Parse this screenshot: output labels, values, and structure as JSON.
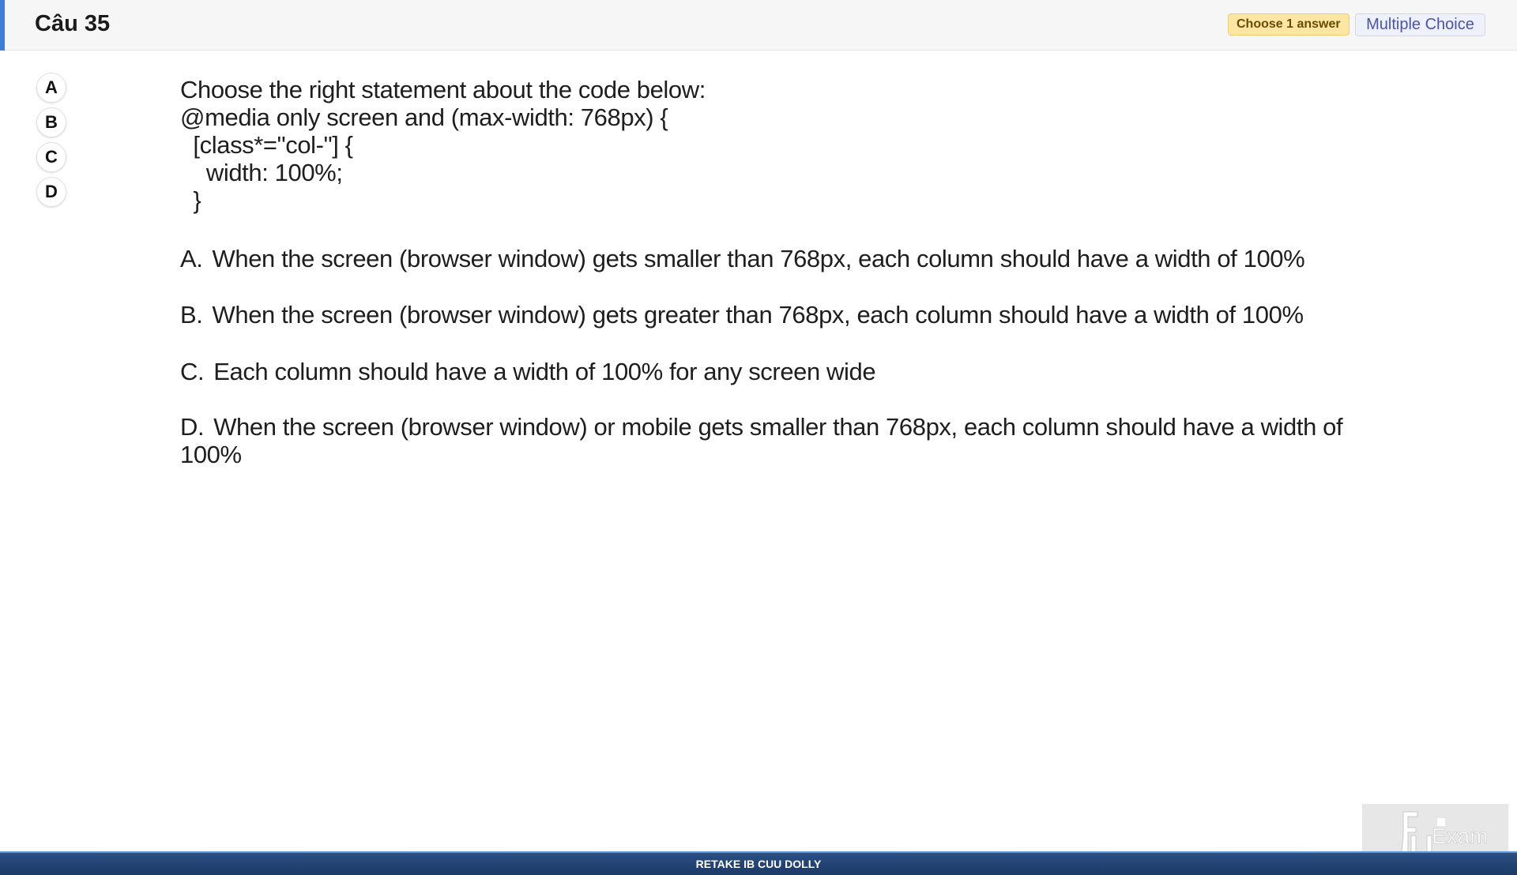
{
  "header": {
    "title": "Câu 35",
    "choose_badge": "Choose 1 answer",
    "type_badge": "Multiple Choice"
  },
  "options": [
    "A",
    "B",
    "C",
    "D"
  ],
  "question": {
    "lines": [
      "Choose the right statement about the code below:",
      "@media only screen and (max-width: 768px) {",
      "  [class*=\"col-\"] {",
      "    width: 100%;",
      "  }"
    ]
  },
  "answers": [
    {
      "letter": "A.",
      "text": "When the screen (browser window) gets smaller than 768px, each column should have a width of 100%"
    },
    {
      "letter": "B.",
      "text": "When the screen (browser window) gets greater than 768px, each column should have a width of 100%"
    },
    {
      "letter": "C.",
      "text": "Each column should have a width of 100% for any screen wide"
    },
    {
      "letter": "D.",
      "text": "When the screen (browser window) or mobile gets smaller than 768px, each column should have a width of 100%"
    }
  ],
  "footer": {
    "text": "RETAKE IB CUU DOLLY"
  },
  "watermark": {
    "text": "FU Exam"
  },
  "colors": {
    "accent": "#3b7dd8",
    "badge_choose_bg": "#fbe7a3",
    "badge_type_text": "#4a55a8",
    "footer_bg": "#1b3a66"
  }
}
